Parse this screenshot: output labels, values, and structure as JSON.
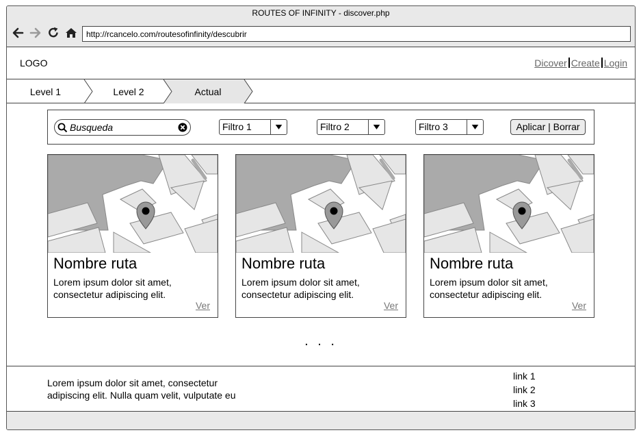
{
  "window": {
    "title": "ROUTES OF INFINITY - discover.php"
  },
  "browser": {
    "url": "http://rcancelo.com/routesofinfinity/descubrir",
    "icons": [
      "back-arrow-icon",
      "forward-arrow-icon",
      "reload-icon",
      "home-icon"
    ]
  },
  "header": {
    "logo": "LOGO",
    "links": [
      "Dicover",
      "Create",
      "Login"
    ]
  },
  "breadcrumb": {
    "items": [
      "Level 1",
      "Level 2",
      "Actual"
    ]
  },
  "filters": {
    "search_value": "Busqueda",
    "filter1": "Filtro 1",
    "filter2": "Filtro 2",
    "filter3": "Filtro 3",
    "apply_label": "Aplicar | Borrar"
  },
  "cards": [
    {
      "title": "Nombre ruta",
      "description": "Lorem ipsum dolor sit amet, consectetur adipiscing elit.",
      "link": "Ver"
    },
    {
      "title": "Nombre ruta",
      "description": "Lorem ipsum dolor sit amet, consectetur adipiscing elit.",
      "link": "Ver"
    },
    {
      "title": "Nombre ruta",
      "description": "Lorem ipsum dolor sit amet, consectetur adipiscing elit.",
      "link": "Ver"
    }
  ],
  "more_indicator": ". . .",
  "footer": {
    "text": "Lorem ipsum dolor sit amet, consectetur adipiscing elit. Nulla quam velit, vulputate eu",
    "links": [
      "link 1",
      "link 2",
      "link 3"
    ]
  },
  "colors": {
    "chrome_bg": "#e9e9e9",
    "map_block": "#aaaaaa",
    "map_bg": "#e6e6e6",
    "active_crumb": "#e6e6e6",
    "link_gray": "#666666"
  }
}
